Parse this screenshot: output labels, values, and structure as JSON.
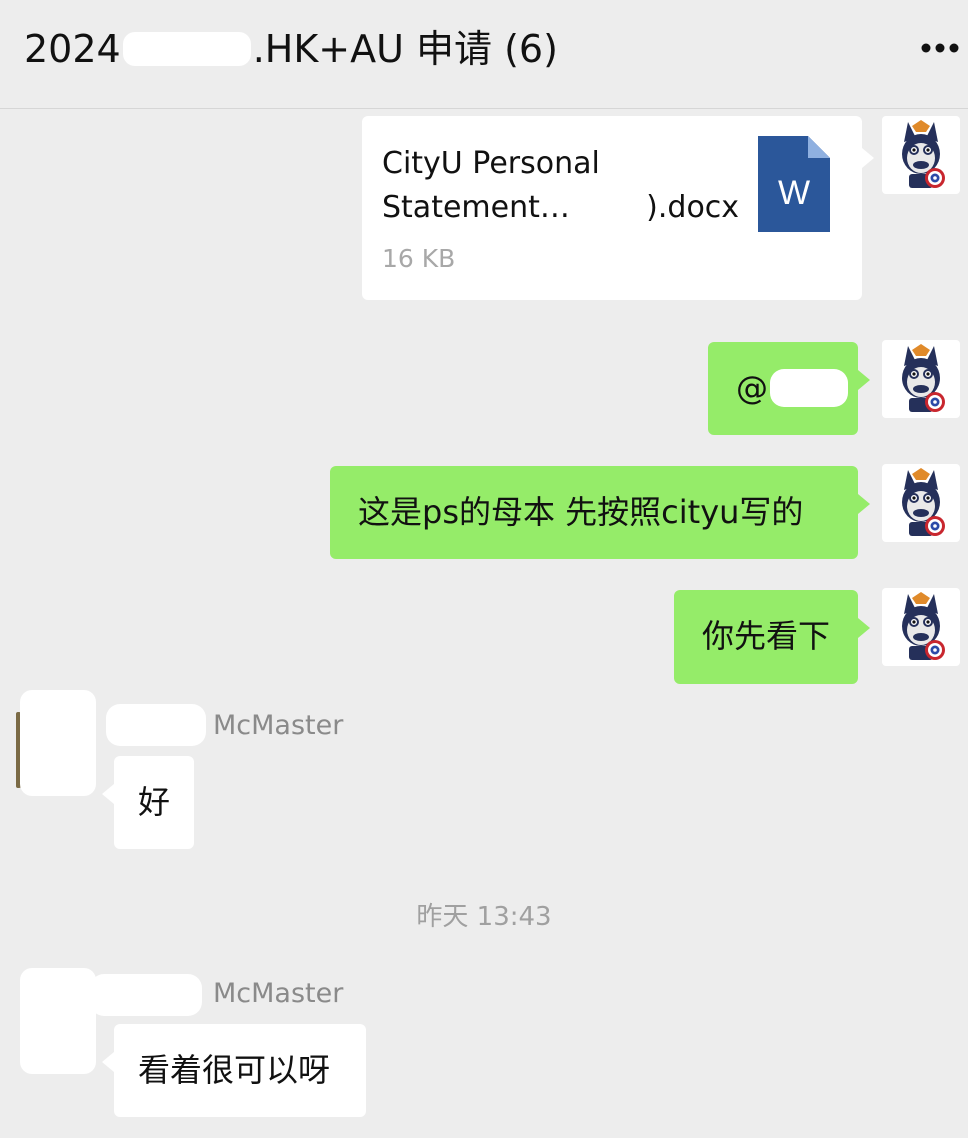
{
  "header": {
    "title_prefix": "2024",
    "title_suffix": ".HK+AU 申请 (6)",
    "more_icon": "more-dots-icon"
  },
  "messages": [
    {
      "type": "file",
      "side": "right",
      "file_name": "CityU Personal\nStatement…        ).docx",
      "file_size": "16 KB",
      "file_icon": "word-document-icon",
      "file_icon_letter": "W"
    },
    {
      "type": "text",
      "side": "right",
      "text": "@",
      "mention_masked": true
    },
    {
      "type": "text",
      "side": "right",
      "text": "这是ps的母本 先按照cityu写的"
    },
    {
      "type": "text",
      "side": "right",
      "text": "你先看下"
    },
    {
      "type": "text",
      "side": "left",
      "sender_suffix": "McMaster",
      "text": "好"
    },
    {
      "type": "time",
      "text": "昨天 13:43"
    },
    {
      "type": "text",
      "side": "left",
      "sender_suffix": "McMaster",
      "text": "看着很可以呀"
    }
  ],
  "colors": {
    "background": "#ededed",
    "my_bubble": "#95ec69",
    "other_bubble": "#ffffff",
    "word_blue": "#2b579a"
  }
}
